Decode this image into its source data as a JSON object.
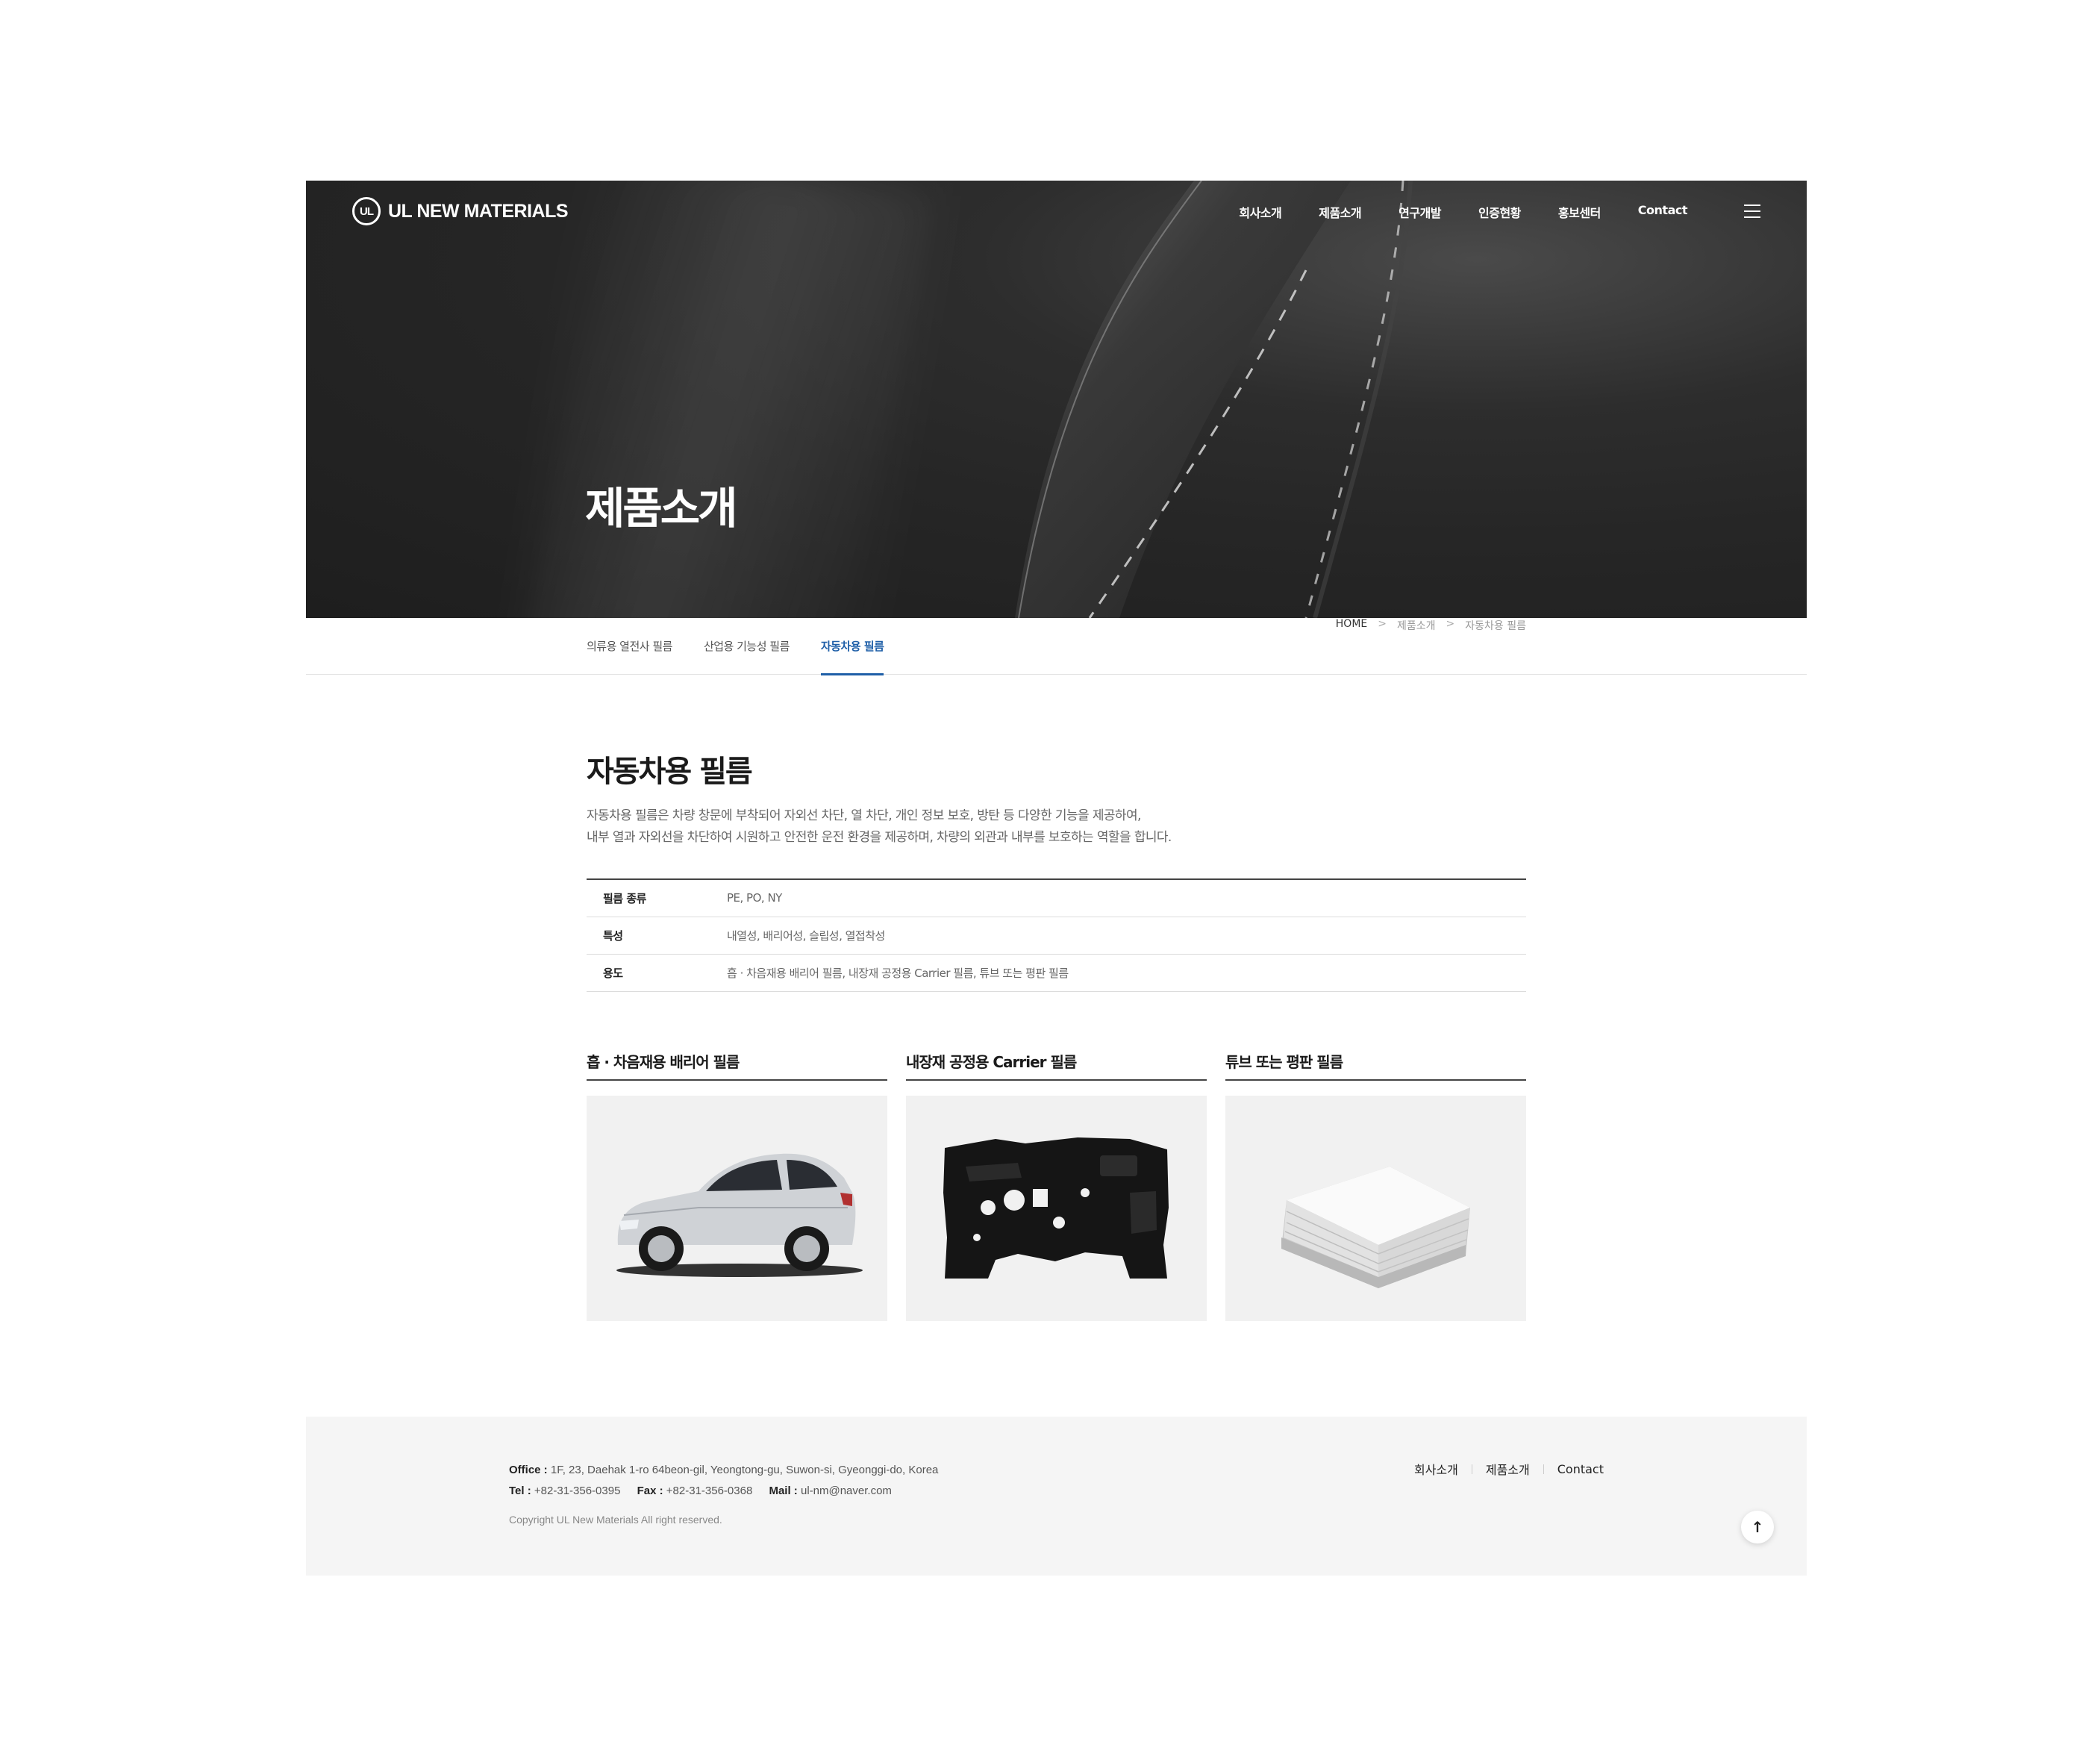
{
  "header": {
    "logo_mark": "UL",
    "logo_text": "UL NEW MATERIALS",
    "nav": [
      "회사소개",
      "제품소개",
      "연구개발",
      "인증현황",
      "홍보센터",
      "Contact"
    ],
    "menu_icon": "hamburger-icon"
  },
  "hero": {
    "title": "제품소개"
  },
  "subnav": {
    "tabs": [
      "의류용 열전사 필름",
      "산업용 기능성 필름",
      "자동차용 필름"
    ],
    "active_tab": "자동차용 필름",
    "breadcrumb": {
      "home": "HOME",
      "level1": "제품소개",
      "level2": "자동차용 필름",
      "separator": ">"
    }
  },
  "content": {
    "title": "자동차용 필름",
    "desc_line1": "자동차용 필름은 차량 창문에 부착되어 자외선 차단, 열 차단, 개인 정보 보호, 방탄 등 다양한 기능을 제공하여,",
    "desc_line2": "내부 열과 자외선을 차단하여 시원하고 안전한 운전 환경을 제공하며, 차량의 외관과 내부를 보호하는 역할을 합니다.",
    "spec": [
      {
        "label": "필름 종류",
        "value": "PE, PO, NY"
      },
      {
        "label": "특성",
        "value": "내열성, 배리어성, 슬립성, 열접착성"
      },
      {
        "label": "용도",
        "value": "흡 · 차음재용 배리어 필름, 내장재 공정용 Carrier 필름, 튜브 또는 평판 필름"
      }
    ],
    "cards": [
      {
        "title": "흡 · 차음재용 배리어 필름",
        "image": "silver-sedan-car"
      },
      {
        "title": "내장재 공정용 Carrier 필름",
        "image": "black-interior-panel"
      },
      {
        "title": "튜브 또는 평판 필름",
        "image": "stack-of-white-film-sheets"
      }
    ]
  },
  "footer": {
    "office_label": "Office :",
    "office": "1F, 23, Daehak 1-ro 64beon-gil, Yeongtong-gu, Suwon-si, Gyeonggi-do, Korea",
    "tel_label": "Tel :",
    "tel": "+82-31-356-0395",
    "fax_label": "Fax :",
    "fax": "+82-31-356-0368",
    "mail_label": "Mail :",
    "mail": "ul-nm@naver.com",
    "copyright": "Copyright UL New Materials All right reserved.",
    "links": [
      "회사소개",
      "제품소개",
      "Contact"
    ],
    "top_button": "↑"
  },
  "colors": {
    "accent": "#1f5fa8",
    "hero_bg": "#262626",
    "footer_bg": "#f5f5f5"
  }
}
